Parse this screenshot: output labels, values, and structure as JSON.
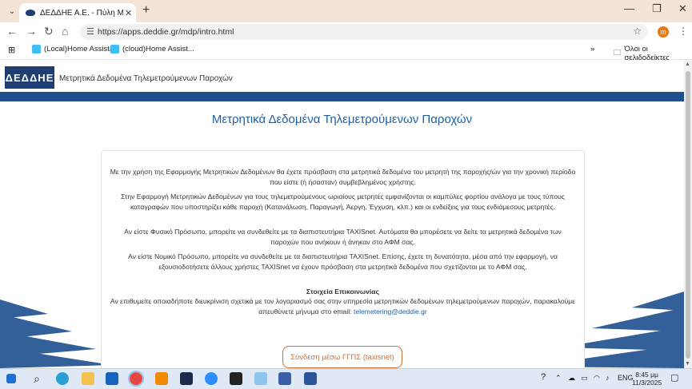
{
  "browser": {
    "tab_title": "ΔΕΔΔΗΕ Α.Ε. - Πύλη Μετρητικώ",
    "url": "https://apps.deddie.gr/mdp/intro.html",
    "profile_initial": "m",
    "bookmarks": [
      {
        "label": "(Local)Home Assista..."
      },
      {
        "label": "(cloud)Home Assist..."
      }
    ],
    "all_bookmarks_label": "Όλοι οι σελιδοδείκτες"
  },
  "site": {
    "logo_text": "ΔΕΔΔΗΕ",
    "title": "Μετρητικά Δεδομένα Τηλεμετρούμενων Παροχών",
    "heading": "Μετρητικά Δεδομένα Τηλεμετρούμενων Παροχών",
    "paragraphs": [
      "Με την χρήση της Εφαρμογής Μετρητικών Δεδομένων θα έχετε πρόσβαση στα μετρητικά δεδομένα του μετρητή της παροχής/ών για την χρονική περίοδο που είστε (ή ήσασταν) συμβεβλημένος χρήστης.",
      "Στην Εφαρμογή Μετρητικών Δεδομένων για τους τηλεμετρούμενους ωριαίους μετρητές εμφανίζονται οι καμπύλες φορτίου ανάλογα με τους τύπους καταγραφών που υποστηρίζει κάθε παροχή (Κατανάλωση, Παραγωγή, Άεργη, Έγχυση, κλπ.) και οι ενδείξεις για τους ενδιάμεσους μετρητές.",
      "Αν είστε Φυσικό Πρόσωπο, μπορείτε να συνδεθείτε με τα διαπιστευτήρια TAXISnet. Αυτόματα θα μπορέσετε να δείτε τα μετρητικά δεδομένα των παροχών που ανήκουν ή άνηκαν στο ΑΦΜ σας.",
      "Αν είστε Νομικό Πρόσωπο, μπορείτε να συνδεθείτε με τα διαπιστευτήρια TAXISnet. Επίσης, έχετε τη δυνατότητα, μέσα από την εφαρμογή, να εξουσιοδοτήσετε άλλους χρήστες TAXISnet να έχουν πρόσβαση στα μετρητικά δεδομένα που σχετίζονται με το ΑΦΜ σας."
    ],
    "contact_title": "Στοιχεία Επικοινωνίας",
    "contact_text": "Αν επιθυμείτε οποιαδήποτε διευκρίνιση σχετικά με τον λογαριασμό σας στην υπηρεσία μετρητικών δεδομένων τηλεμετρούμενων παροχών, παρακαλούμε απευθύνετε μήνυμα στο email:",
    "contact_email": "telemetering@deddie.gr",
    "login_button": "Σύνδεση μέσω ΓΓΠΣ (taxisnet)"
  },
  "taskbar": {
    "language": "ENG",
    "time": "8:45 μμ",
    "date": "11/3/2025"
  },
  "colors": {
    "brand_blue": "#1d3d73",
    "heading_blue": "#1f5f9f",
    "button_orange": "#d07030"
  }
}
